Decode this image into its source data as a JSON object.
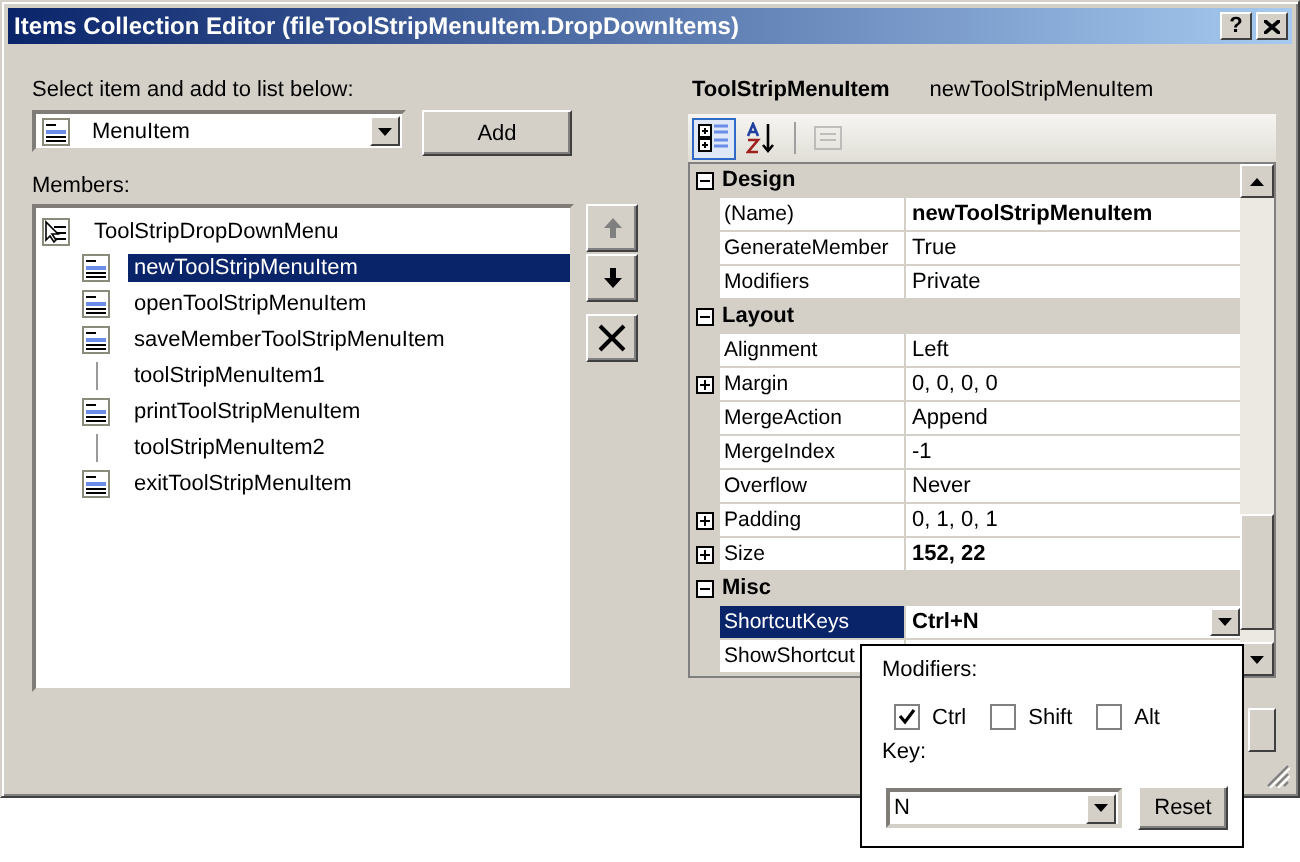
{
  "window": {
    "title": "Items Collection Editor (fileToolStripMenuItem.DropDownItems)",
    "help_button": "?"
  },
  "select_label": "Select item and add to list below:",
  "item_type": {
    "value": "MenuItem"
  },
  "add_button": "Add",
  "members_label": "Members:",
  "members": [
    {
      "label": "ToolStripDropDownMenu",
      "kind": "root",
      "selected": false,
      "children": [
        {
          "label": "newToolStripMenuItem",
          "kind": "menu-item",
          "selected": true
        },
        {
          "label": "openToolStripMenuItem",
          "kind": "menu-item",
          "selected": false
        },
        {
          "label": "saveMemberToolStripMenuItem",
          "kind": "menu-item",
          "selected": false
        },
        {
          "label": "toolStripMenuItem1",
          "kind": "separator",
          "selected": false
        },
        {
          "label": "printToolStripMenuItem",
          "kind": "menu-item",
          "selected": false
        },
        {
          "label": "toolStripMenuItem2",
          "kind": "separator",
          "selected": false
        },
        {
          "label": "exitToolStripMenuItem",
          "kind": "menu-item",
          "selected": false
        }
      ]
    }
  ],
  "order_buttons": [
    {
      "kind": "move-up",
      "disabled": true
    },
    {
      "kind": "move-down",
      "disabled": false
    },
    {
      "kind": "delete",
      "disabled": false
    }
  ],
  "object_type": "ToolStripMenuItem",
  "object_name": "newToolStripMenuItem",
  "toolbar": [
    {
      "kind": "categorized",
      "selected": true,
      "disabled": false
    },
    {
      "kind": "alphabetical",
      "selected": false,
      "disabled": false
    },
    {
      "kind": "property-pages",
      "selected": false,
      "disabled": true
    }
  ],
  "categories": [
    {
      "name": "Design",
      "expanded": true,
      "properties": [
        {
          "name": "(Name)",
          "value": "newToolStripMenuItem",
          "modified": true,
          "expandable": false,
          "selected": false
        },
        {
          "name": "GenerateMember",
          "value": "True",
          "modified": false,
          "expandable": false,
          "selected": false
        },
        {
          "name": "Modifiers",
          "value": "Private",
          "modified": false,
          "expandable": false,
          "selected": false
        }
      ]
    },
    {
      "name": "Layout",
      "expanded": true,
      "properties": [
        {
          "name": "Alignment",
          "value": "Left",
          "modified": false,
          "expandable": false,
          "selected": false
        },
        {
          "name": "Margin",
          "value": "0, 0, 0, 0",
          "modified": false,
          "expandable": true,
          "selected": false
        },
        {
          "name": "MergeAction",
          "value": "Append",
          "modified": false,
          "expandable": false,
          "selected": false
        },
        {
          "name": "MergeIndex",
          "value": "-1",
          "modified": false,
          "expandable": false,
          "selected": false
        },
        {
          "name": "Overflow",
          "value": "Never",
          "modified": false,
          "expandable": false,
          "selected": false
        },
        {
          "name": "Padding",
          "value": "0, 1, 0, 1",
          "modified": false,
          "expandable": true,
          "selected": false
        },
        {
          "name": "Size",
          "value": "152, 22",
          "modified": true,
          "expandable": true,
          "selected": false
        }
      ]
    },
    {
      "name": "Misc",
      "expanded": true,
      "properties": [
        {
          "name": "ShortcutKeys",
          "value": "Ctrl+N",
          "modified": true,
          "expandable": false,
          "selected": true
        },
        {
          "name": "ShowShortcut",
          "expandable": false,
          "selected": false
        }
      ]
    }
  ],
  "shortcut_popup": {
    "modifiers_label": "Modifiers:",
    "modifiers": [
      {
        "label": "Ctrl",
        "checked": true
      },
      {
        "label": "Shift",
        "checked": false
      },
      {
        "label": "Alt",
        "checked": false
      }
    ],
    "key_label": "Key:",
    "key": {
      "value": "N"
    },
    "reset_button": "Reset"
  }
}
